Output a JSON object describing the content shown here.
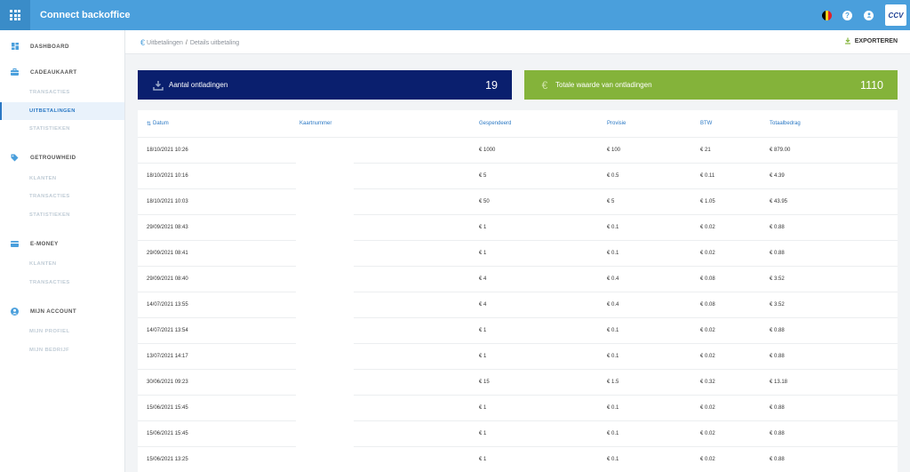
{
  "app": {
    "title": "Connect backoffice",
    "logo_text": "CCV"
  },
  "topbar": {
    "flag_colors": [
      "#000000",
      "#f7d117",
      "#e0202a"
    ],
    "help_icon": "?",
    "account_icon": "person"
  },
  "sidebar": {
    "sections": [
      {
        "label": "DASHBOARD",
        "icon": "dashboard-icon",
        "items": []
      },
      {
        "label": "CADEAUKAART",
        "icon": "briefcase-icon",
        "items": [
          {
            "label": "TRANSACTIES",
            "active": false
          },
          {
            "label": "UITBETALINGEN",
            "active": true
          },
          {
            "label": "STATISTIEKEN",
            "active": false
          }
        ]
      },
      {
        "label": "GETROUWHEID",
        "icon": "tag-icon",
        "items": [
          {
            "label": "KLANTEN",
            "active": false
          },
          {
            "label": "TRANSACTIES",
            "active": false
          },
          {
            "label": "STATISTIEKEN",
            "active": false
          }
        ]
      },
      {
        "label": "E-MONEY",
        "icon": "card-icon",
        "items": [
          {
            "label": "KLANTEN",
            "active": false
          },
          {
            "label": "TRANSACTIES",
            "active": false
          }
        ]
      },
      {
        "label": "MIJN ACCOUNT",
        "icon": "account-icon",
        "items": [
          {
            "label": "MIJN PROFIEL",
            "active": false
          },
          {
            "label": "MIJN BEDRIJF",
            "active": false
          }
        ]
      }
    ]
  },
  "breadcrumb": {
    "parent": "Uitbetalingen",
    "separator": "/",
    "current": "Details uitbetaling"
  },
  "export_label": "EXPORTEREN",
  "cards": [
    {
      "label": "Aantal ontladingen",
      "value": "19",
      "color": "#0a1f6e"
    },
    {
      "label": "Totale waarde van ontladingen",
      "value": "1110",
      "color": "#84b33a"
    }
  ],
  "table": {
    "columns": [
      "Datum",
      "Kaartnummer",
      "Gespendeerd",
      "Provisie",
      "BTW",
      "Totaalbedrag"
    ],
    "rows": [
      [
        "18/10/2021 10:26",
        "",
        "€ 1000",
        "€ 100",
        "€ 21",
        "€ 879.00"
      ],
      [
        "18/10/2021 10:16",
        "",
        "€ 5",
        "€ 0.5",
        "€ 0.11",
        "€ 4.39"
      ],
      [
        "18/10/2021 10:03",
        "",
        "€ 50",
        "€ 5",
        "€ 1.05",
        "€ 43.95"
      ],
      [
        "29/09/2021 08:43",
        "",
        "€ 1",
        "€ 0.1",
        "€ 0.02",
        "€ 0.88"
      ],
      [
        "29/09/2021 08:41",
        "",
        "€ 1",
        "€ 0.1",
        "€ 0.02",
        "€ 0.88"
      ],
      [
        "29/09/2021 08:40",
        "",
        "€ 4",
        "€ 0.4",
        "€ 0.08",
        "€ 3.52"
      ],
      [
        "14/07/2021 13:55",
        "",
        "€ 4",
        "€ 0.4",
        "€ 0.08",
        "€ 3.52"
      ],
      [
        "14/07/2021 13:54",
        "",
        "€ 1",
        "€ 0.1",
        "€ 0.02",
        "€ 0.88"
      ],
      [
        "13/07/2021 14:17",
        "",
        "€ 1",
        "€ 0.1",
        "€ 0.02",
        "€ 0.88"
      ],
      [
        "30/06/2021 09:23",
        "",
        "€ 15",
        "€ 1.5",
        "€ 0.32",
        "€ 13.18"
      ],
      [
        "15/06/2021 15:45",
        "",
        "€ 1",
        "€ 0.1",
        "€ 0.02",
        "€ 0.88"
      ],
      [
        "15/06/2021 15:45",
        "",
        "€ 1",
        "€ 0.1",
        "€ 0.02",
        "€ 0.88"
      ],
      [
        "15/06/2021 13:25",
        "",
        "€ 1",
        "€ 0.1",
        "€ 0.02",
        "€ 0.88"
      ]
    ]
  }
}
